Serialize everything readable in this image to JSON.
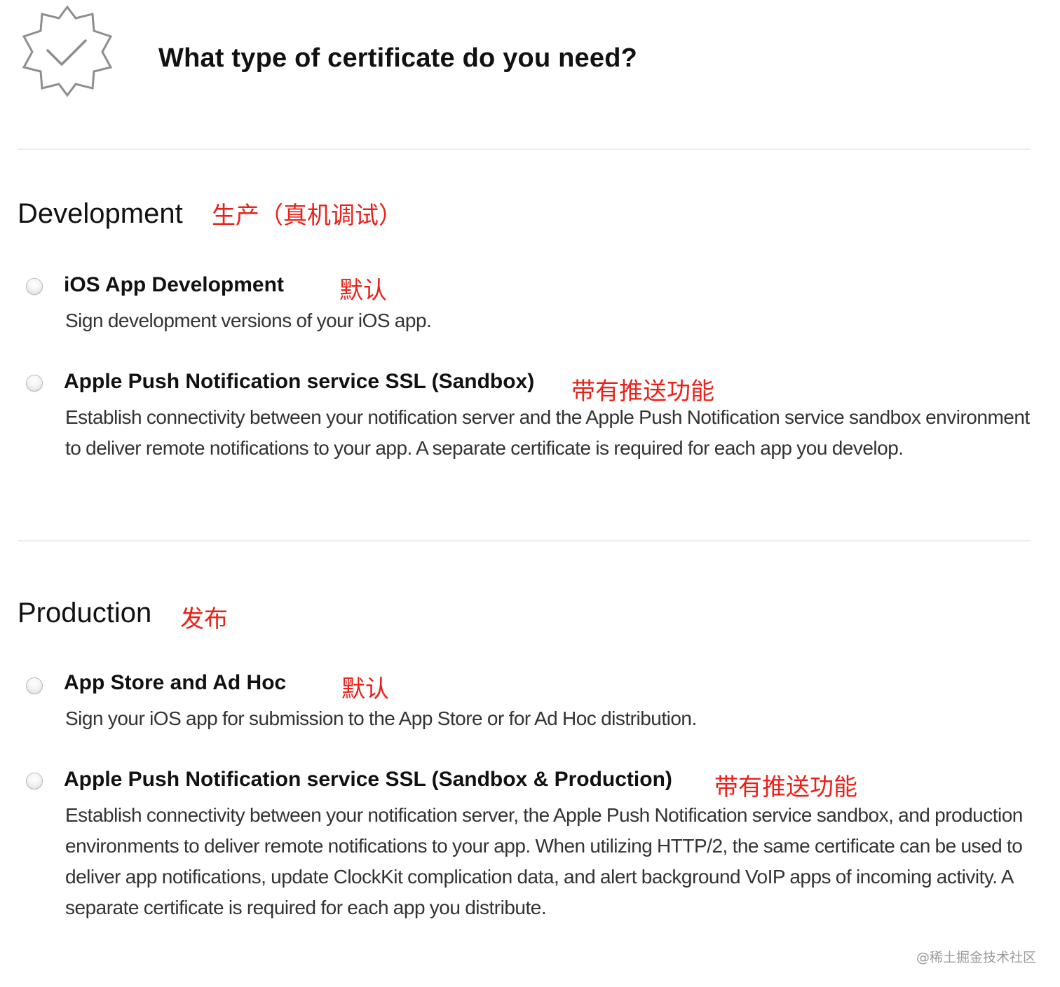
{
  "header": {
    "icon": "certificate-badge-icon",
    "title": "What type of certificate do you need?"
  },
  "sections": [
    {
      "title": "Development",
      "annotation": "生产（真机调试）",
      "options": [
        {
          "title": "iOS App Development",
          "annotation": "默认",
          "description": "Sign development versions of your iOS app.",
          "selected": false
        },
        {
          "title": "Apple Push Notification service SSL (Sandbox)",
          "annotation": "带有推送功能",
          "description": "Establish connectivity between your notification server and the Apple Push Notification service sandbox environment to deliver remote notifications to your app. A separate certificate is required for each app you develop.",
          "selected": false
        }
      ]
    },
    {
      "title": "Production",
      "annotation": "发布",
      "options": [
        {
          "title": "App Store and Ad Hoc",
          "annotation": "默认",
          "description": "Sign your iOS app for submission to the App Store or for Ad Hoc distribution.",
          "selected": false
        },
        {
          "title": "Apple Push Notification service SSL (Sandbox & Production)",
          "annotation": "带有推送功能",
          "description": "Establish connectivity between your notification server, the Apple Push Notification service sandbox, and production environments to deliver remote notifications to your app. When utilizing HTTP/2, the same certificate can be used to deliver app notifications, update ClockKit complication data, and alert background VoIP apps of incoming activity. A separate certificate is required for each app you distribute.",
          "selected": false
        }
      ]
    }
  ],
  "colors": {
    "annotation": "#e8221b",
    "divider": "#ececec",
    "text": "#111111"
  },
  "watermark": "@稀土掘金技术社区"
}
